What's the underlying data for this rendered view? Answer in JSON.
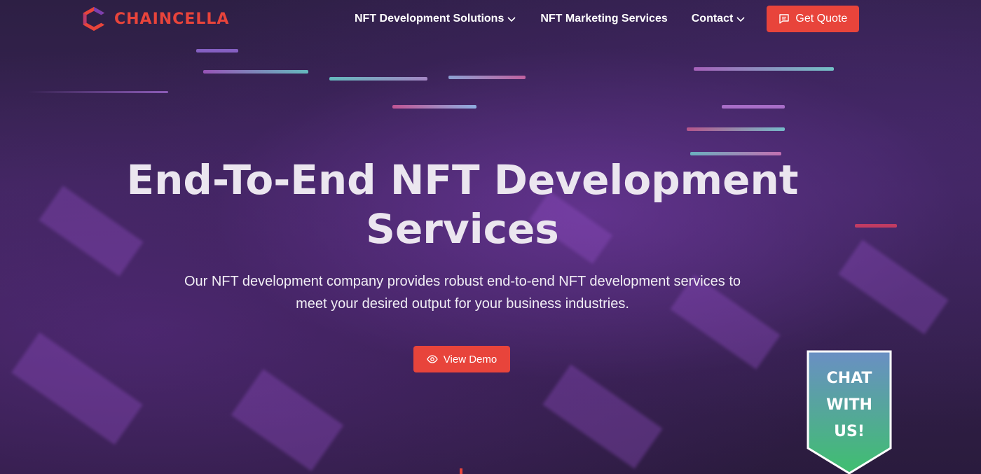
{
  "brand": {
    "name": "CHAINCELLA",
    "color": "#e8443b"
  },
  "nav": {
    "items": [
      {
        "label": "NFT Development Solutions",
        "has_dropdown": true
      },
      {
        "label": "NFT Marketing Services",
        "has_dropdown": false
      },
      {
        "label": "Contact",
        "has_dropdown": true
      }
    ],
    "cta_label": "Get Quote",
    "cta_icon": "message-icon"
  },
  "hero": {
    "title_line1": "End-To-End NFT Development",
    "title_line2": "Services",
    "subtitle_line1": "Our NFT development company provides robust end-to-end NFT development services to",
    "subtitle_line2": "meet your desired output for your business industries.",
    "demo_label": "View Demo",
    "demo_icon": "eye-icon"
  },
  "chat": {
    "text": "CHAT\nWITH\nUS!"
  },
  "colors": {
    "accent": "#e8443b",
    "chat_gradient_top": "#6a8fc4",
    "chat_gradient_bottom": "#3fbf6f",
    "background": "#2a1d3f"
  }
}
